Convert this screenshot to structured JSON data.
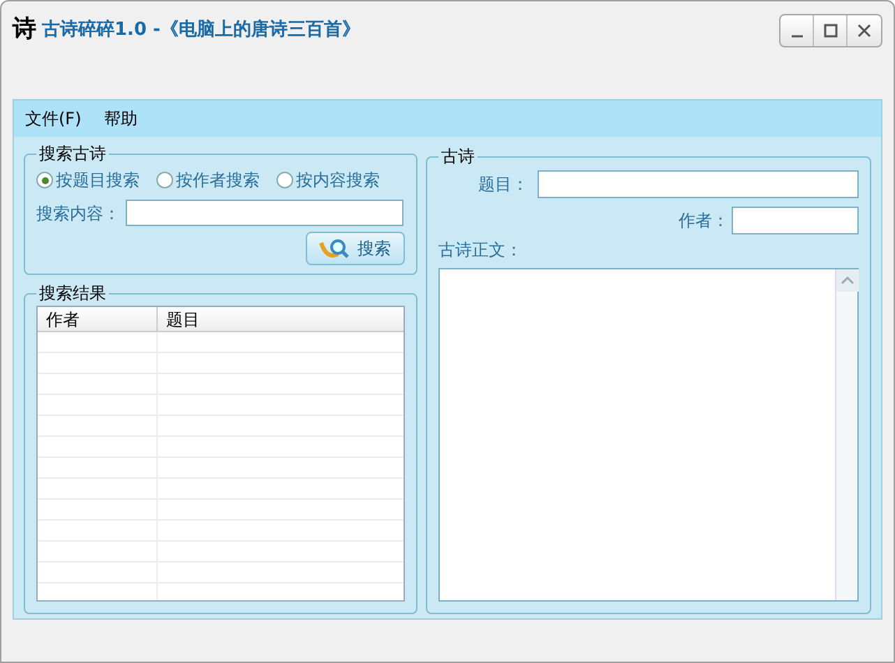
{
  "window": {
    "icon_text": "诗",
    "title": "古诗碎碎1.0 -《电脑上的唐诗三百首》"
  },
  "menu": [
    "文件(F)",
    "帮助"
  ],
  "search_group": {
    "title": "搜索古诗",
    "modes": [
      {
        "label": "按题目搜索",
        "selected": true
      },
      {
        "label": "按作者搜索",
        "selected": false
      },
      {
        "label": "按内容搜索",
        "selected": false
      }
    ],
    "content_label": "搜索内容：",
    "button": "搜索"
  },
  "results_group": {
    "title": "搜索结果",
    "columns": [
      "作者",
      "题目"
    ]
  },
  "poem_group": {
    "title": "古诗",
    "title_label": "题目：",
    "author_label": "作者：",
    "body_label": "古诗正文："
  }
}
